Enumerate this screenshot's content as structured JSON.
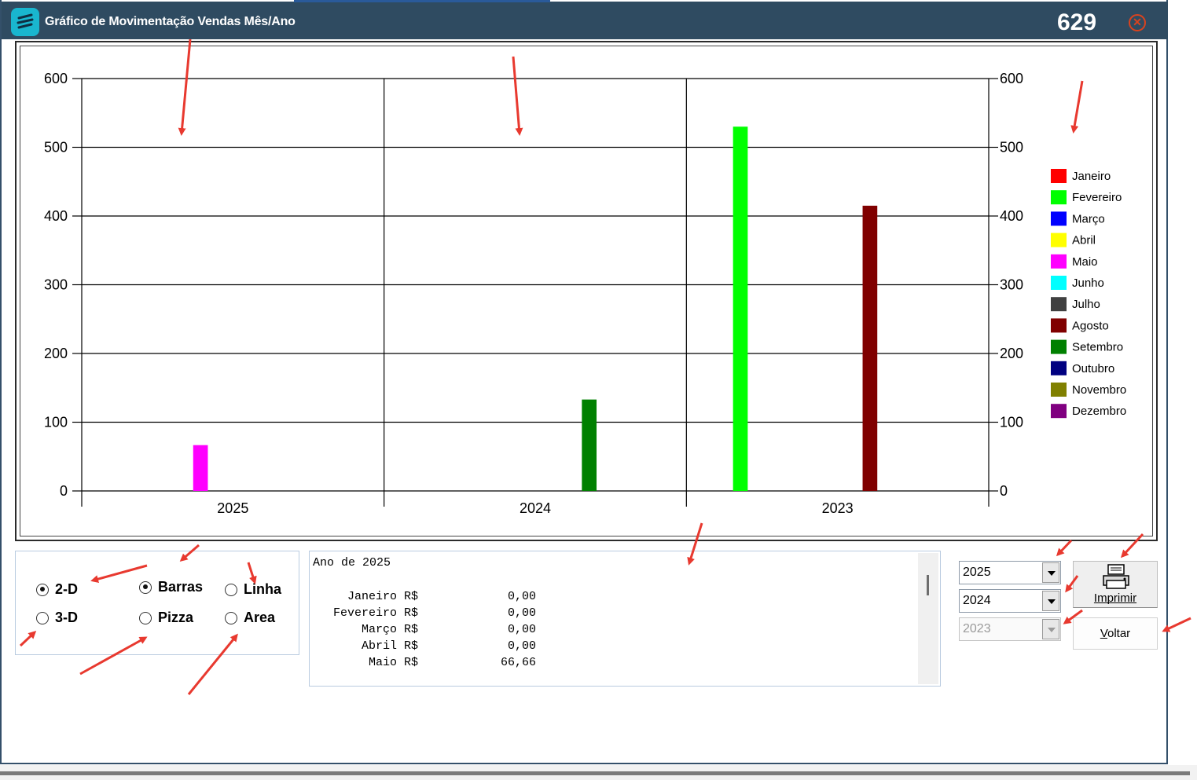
{
  "window": {
    "title": "Gráfico de Movimentação Vendas Mês/Ano",
    "number": "629",
    "close_icon": "close-circle-icon"
  },
  "colors": {
    "titlebar": "#2f4b61",
    "app_icon": "#19b6cf",
    "close": "#d9431e",
    "annotation_arrow": "#e8392f"
  },
  "chart_data": {
    "type": "bar",
    "categories": [
      "2025",
      "2024",
      "2023"
    ],
    "ylim": [
      0,
      600
    ],
    "yticks": [
      0,
      100,
      200,
      300,
      400,
      500,
      600
    ],
    "ytick_labels": [
      "0",
      "100",
      "200",
      "300",
      "400",
      "500",
      "600"
    ],
    "grid": true,
    "legend_position": "right",
    "months": [
      "Janeiro",
      "Fevereiro",
      "Março",
      "Abril",
      "Maio",
      "Junho",
      "Julho",
      "Agosto",
      "Setembro",
      "Outubro",
      "Novembro",
      "Dezembro"
    ],
    "month_colors": [
      "#ff0000",
      "#00ff00",
      "#0000ff",
      "#ffff00",
      "#ff00ff",
      "#00ffff",
      "#404040",
      "#800000",
      "#008000",
      "#000080",
      "#808000",
      "#800080"
    ],
    "series": [
      {
        "name": "Janeiro",
        "values": [
          0,
          0,
          0
        ]
      },
      {
        "name": "Fevereiro",
        "values": [
          0,
          0,
          530
        ]
      },
      {
        "name": "Março",
        "values": [
          0,
          0,
          0
        ]
      },
      {
        "name": "Abril",
        "values": [
          0,
          0,
          0
        ]
      },
      {
        "name": "Maio",
        "values": [
          66.66,
          0,
          0
        ]
      },
      {
        "name": "Junho",
        "values": [
          0,
          0,
          0
        ]
      },
      {
        "name": "Julho",
        "values": [
          0,
          0,
          0
        ]
      },
      {
        "name": "Agosto",
        "values": [
          0,
          0,
          415
        ]
      },
      {
        "name": "Setembro",
        "values": [
          0,
          133,
          0
        ]
      },
      {
        "name": "Outubro",
        "values": [
          0,
          0,
          0
        ]
      },
      {
        "name": "Novembro",
        "values": [
          0,
          0,
          0
        ]
      },
      {
        "name": "Dezembro",
        "values": [
          0,
          0,
          0
        ]
      }
    ]
  },
  "options": {
    "dim_2d": "2-D",
    "dim_3d": "3-D",
    "barras": "Barras",
    "pizza": "Pizza",
    "linha": "Linha",
    "area": "Area",
    "selected_dimension": "2-D",
    "selected_type": "Barras"
  },
  "memo": {
    "title": "Ano de 2025",
    "rows": [
      {
        "label": "Janeiro R$",
        "value": "0,00"
      },
      {
        "label": "Fevereiro R$",
        "value": "0,00"
      },
      {
        "label": "Março R$",
        "value": "0,00"
      },
      {
        "label": "Abril R$",
        "value": "0,00"
      },
      {
        "label": "Maio R$",
        "value": "66,66"
      }
    ]
  },
  "year_selects": {
    "year1": "2025",
    "year2": "2024",
    "year3": "2023"
  },
  "buttons": {
    "print_label": "Imprimir",
    "print_icon": "printer-icon",
    "voltar_label_first": "V",
    "voltar_label_rest": "oltar"
  }
}
